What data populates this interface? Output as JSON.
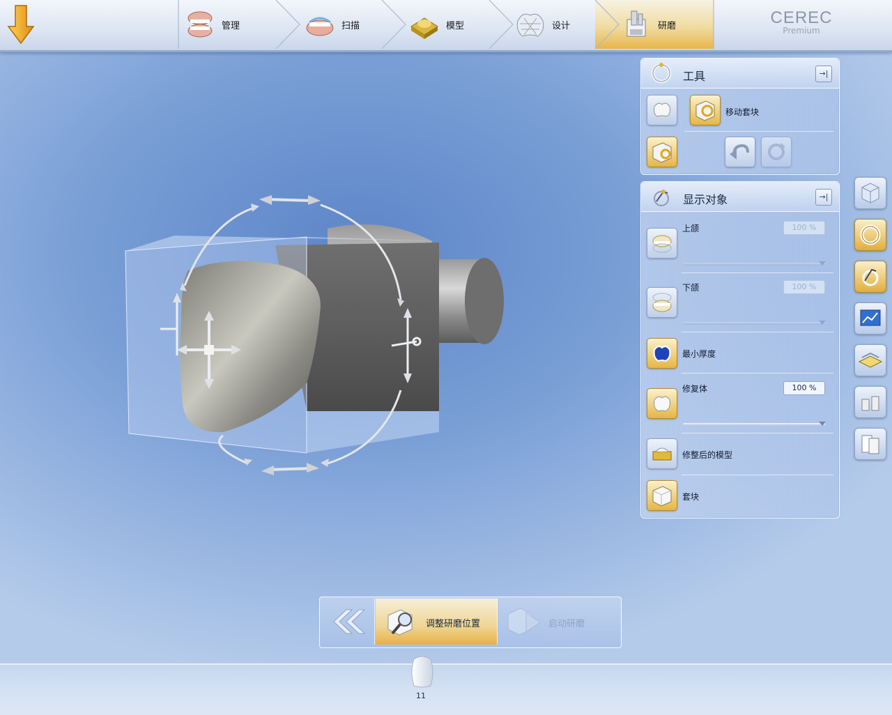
{
  "header": {
    "steps": [
      {
        "label": "管理",
        "icon": "jaw-management-icon"
      },
      {
        "label": "扫描",
        "icon": "jaw-scan-icon"
      },
      {
        "label": "模型",
        "icon": "model-icon"
      },
      {
        "label": "设计",
        "icon": "crown-design-icon"
      },
      {
        "label": "研磨",
        "icon": "milling-icon",
        "active": true
      }
    ],
    "brand_title": "CEREC",
    "brand_subtitle": "Premium"
  },
  "tools_panel": {
    "title": "工具",
    "pin_label": "→|",
    "move_block_label": "移动套块"
  },
  "display_panel": {
    "title": "显示对象",
    "pin_label": "→|",
    "rows": [
      {
        "label": "上颌",
        "percent": "100 %"
      },
      {
        "label": "下颌",
        "percent": "100 %"
      },
      {
        "label": "最小厚度"
      },
      {
        "label": "修复体",
        "percent": "100 %"
      },
      {
        "label": "修整后的模型"
      },
      {
        "label": "套块"
      }
    ]
  },
  "right_toolbar": [
    "view-cube-icon",
    "tools-ring-icon",
    "display-objects-icon",
    "analysis-chart-icon",
    "material-blocks-icon",
    "milling-units-icon",
    "reports-icon"
  ],
  "action_bar": {
    "prev_label": "«",
    "adjust_label": "调整研磨位置",
    "start_label": "启动研磨"
  },
  "tooth": {
    "number": "11"
  },
  "colors": {
    "accent_gold": "#e6b146",
    "panel_blue": "#c4d5f0",
    "background": "#7a9fd6"
  }
}
